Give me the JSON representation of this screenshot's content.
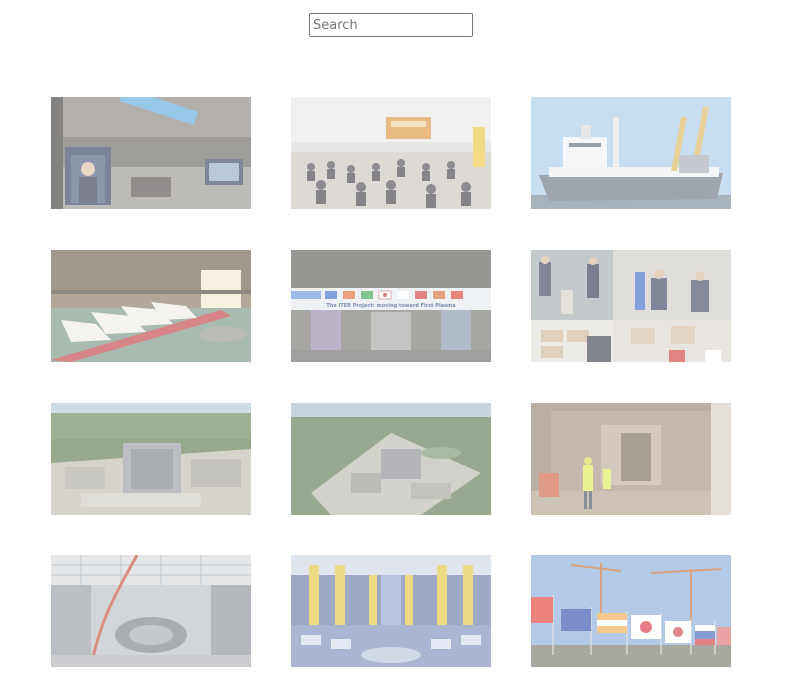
{
  "search": {
    "placeholder": "Search",
    "value": ""
  },
  "gallery": {
    "items": [
      {
        "subject": "press-event-screens"
      },
      {
        "subject": "audience-in-tent"
      },
      {
        "subject": "cargo-ship-cranes"
      },
      {
        "subject": "factory-hall-coils"
      },
      {
        "subject": "assembly-hall-banner",
        "banner_text": "The ITER Project: moving toward First Plasma"
      },
      {
        "subject": "officials-collage"
      },
      {
        "subject": "aerial-site-1"
      },
      {
        "subject": "aerial-site-2"
      },
      {
        "subject": "worker-concrete-chamber"
      },
      {
        "subject": "assembly-hall-interior"
      },
      {
        "subject": "tokamak-pit-columns"
      },
      {
        "subject": "flags-and-cranes"
      }
    ]
  }
}
